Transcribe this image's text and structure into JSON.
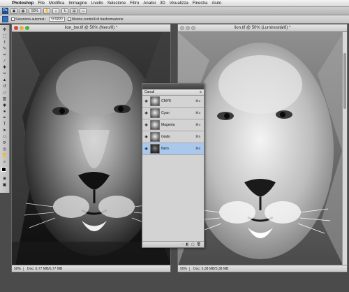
{
  "menubar": {
    "apple": "",
    "app_name": "Photoshop",
    "items": [
      "File",
      "Modifica",
      "Immagine",
      "Livello",
      "Selezione",
      "Filtro",
      "Analisi",
      "3D",
      "Visualizza",
      "Finestra",
      "Aiuto"
    ]
  },
  "appbar": {
    "logo": "Ps",
    "zoom_value": "50%"
  },
  "options": {
    "auto_select_label": "Seleziona automat.:",
    "auto_select_value": "Gruppo",
    "transform_label": "Mostra controlli di trasformazione"
  },
  "doc_left": {
    "title": "lion_bw.tif @ 50% (Nero/8) *",
    "zoom": "50%",
    "status": "Doc: 6,77 MB/6,77 MB"
  },
  "doc_right": {
    "title": "lion.tif @ 50% (Luminosità/8) *",
    "zoom": "50%",
    "status": "Doc: 5,38 MB/5,38 MB"
  },
  "channels_panel": {
    "tab_label": "Canali",
    "menu_icon": "panel-menu-icon",
    "channels": [
      {
        "name": "CMYK",
        "shortcut": "⌘2",
        "active": false,
        "thumb": "light"
      },
      {
        "name": "Cyan",
        "shortcut": "⌘3",
        "active": false,
        "thumb": "light"
      },
      {
        "name": "Magenta",
        "shortcut": "⌘4",
        "active": false,
        "thumb": "light"
      },
      {
        "name": "Giallo",
        "shortcut": "⌘5",
        "active": false,
        "thumb": "light"
      },
      {
        "name": "Nero",
        "shortcut": "⌘6",
        "active": true,
        "thumb": "dark"
      }
    ]
  },
  "colors": {
    "active_row": "#a9c8ec",
    "toolbar_bg": "#c9c9c9",
    "canvas_bg": "#4b4b4b"
  }
}
